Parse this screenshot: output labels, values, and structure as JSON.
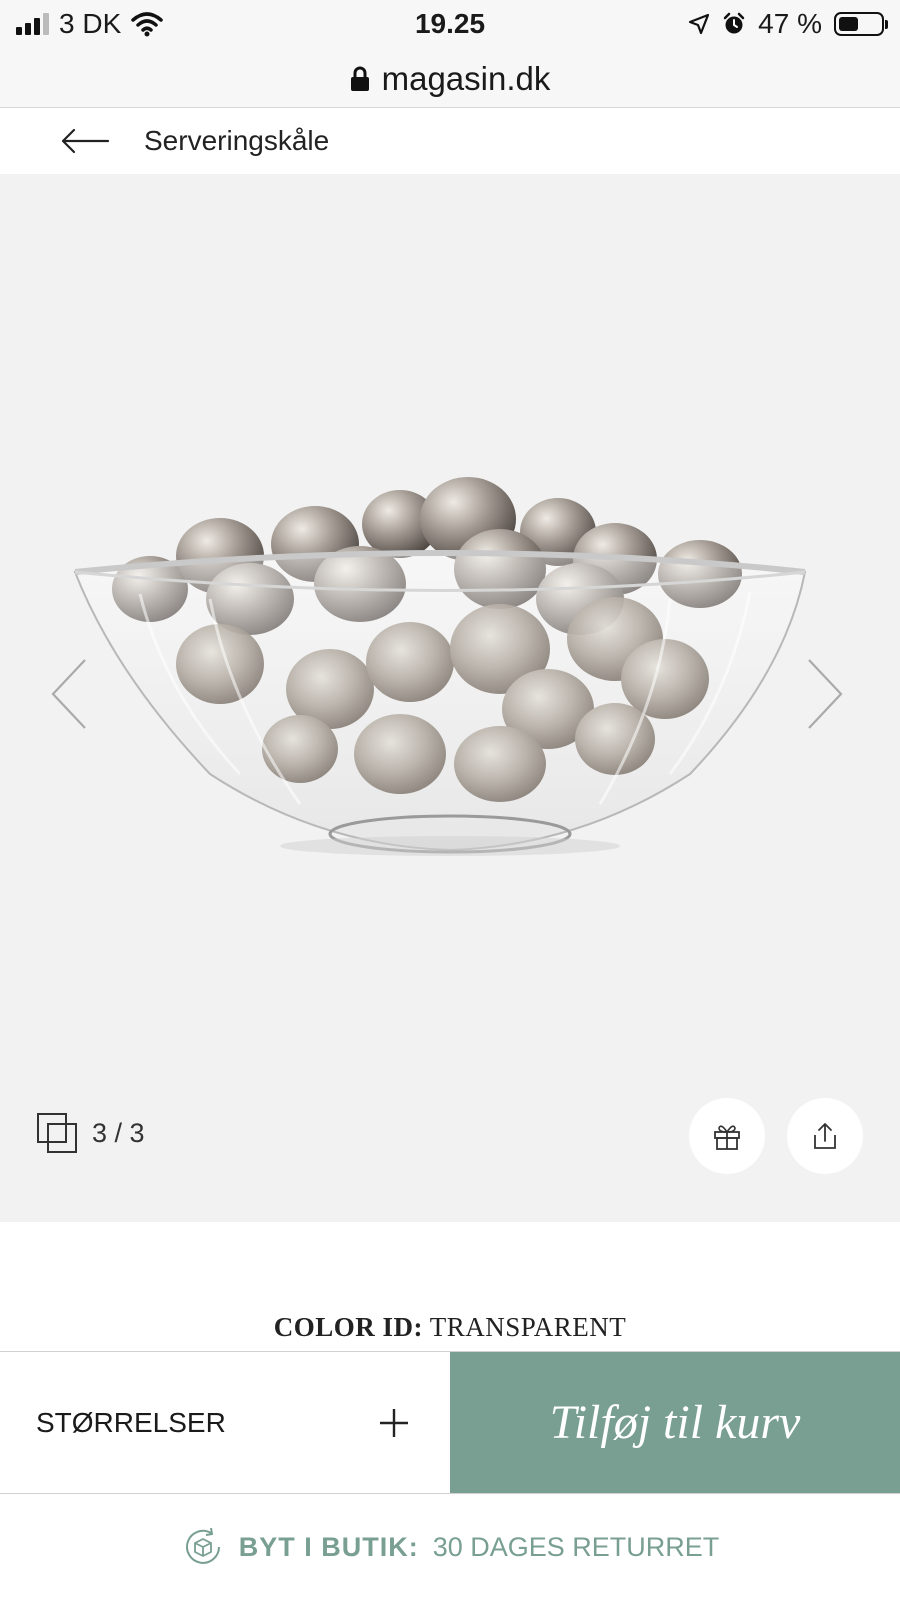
{
  "status_bar": {
    "carrier": "3 DK",
    "time": "19.25",
    "battery": "47 %",
    "battery_level": 0.47
  },
  "browser": {
    "url": "magasin.dk"
  },
  "breadcrumb": {
    "label": "Serveringskåle"
  },
  "gallery": {
    "counter": "3 / 3",
    "current": 3,
    "total": 3
  },
  "product": {
    "color_id_label": "COLOR ID:",
    "color_id_value": "TRANSPARENT"
  },
  "actions": {
    "sizes_label": "STØRRELSER",
    "add_to_cart_label": "Tilføj til kurv"
  },
  "return_info": {
    "label": "BYT I BUTIK:",
    "text": "30 DAGES RETURRET"
  },
  "colors": {
    "accent": "#789f91",
    "gallery_bg": "#f2f2f2"
  }
}
